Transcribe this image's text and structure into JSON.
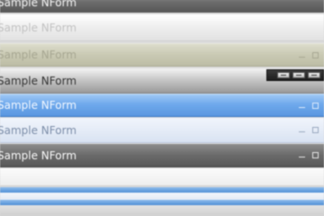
{
  "bars": [
    {
      "title": "Sample NForm",
      "controls": []
    },
    {
      "title": "Sample NForm",
      "controls": []
    },
    {
      "title": "Sample NForm",
      "controls": [
        "minimize",
        "restore"
      ]
    },
    {
      "title": "Sample NForm",
      "controls": []
    },
    {
      "title": "Sample NForm",
      "controls": [
        "minimize",
        "restore"
      ]
    },
    {
      "title": "Sample NForm",
      "controls": [
        "minimize",
        "restore"
      ]
    },
    {
      "title": "Sample NForm",
      "controls": [
        "minimize",
        "restore"
      ]
    }
  ],
  "mini_toolbar": {
    "buttons": [
      "minimize-icon",
      "restore-icon",
      "close-icon"
    ]
  },
  "colors": {
    "selected_blue": "#6fa9ec",
    "olive": "#c9c9b3",
    "dark": "#6a6a6a"
  }
}
